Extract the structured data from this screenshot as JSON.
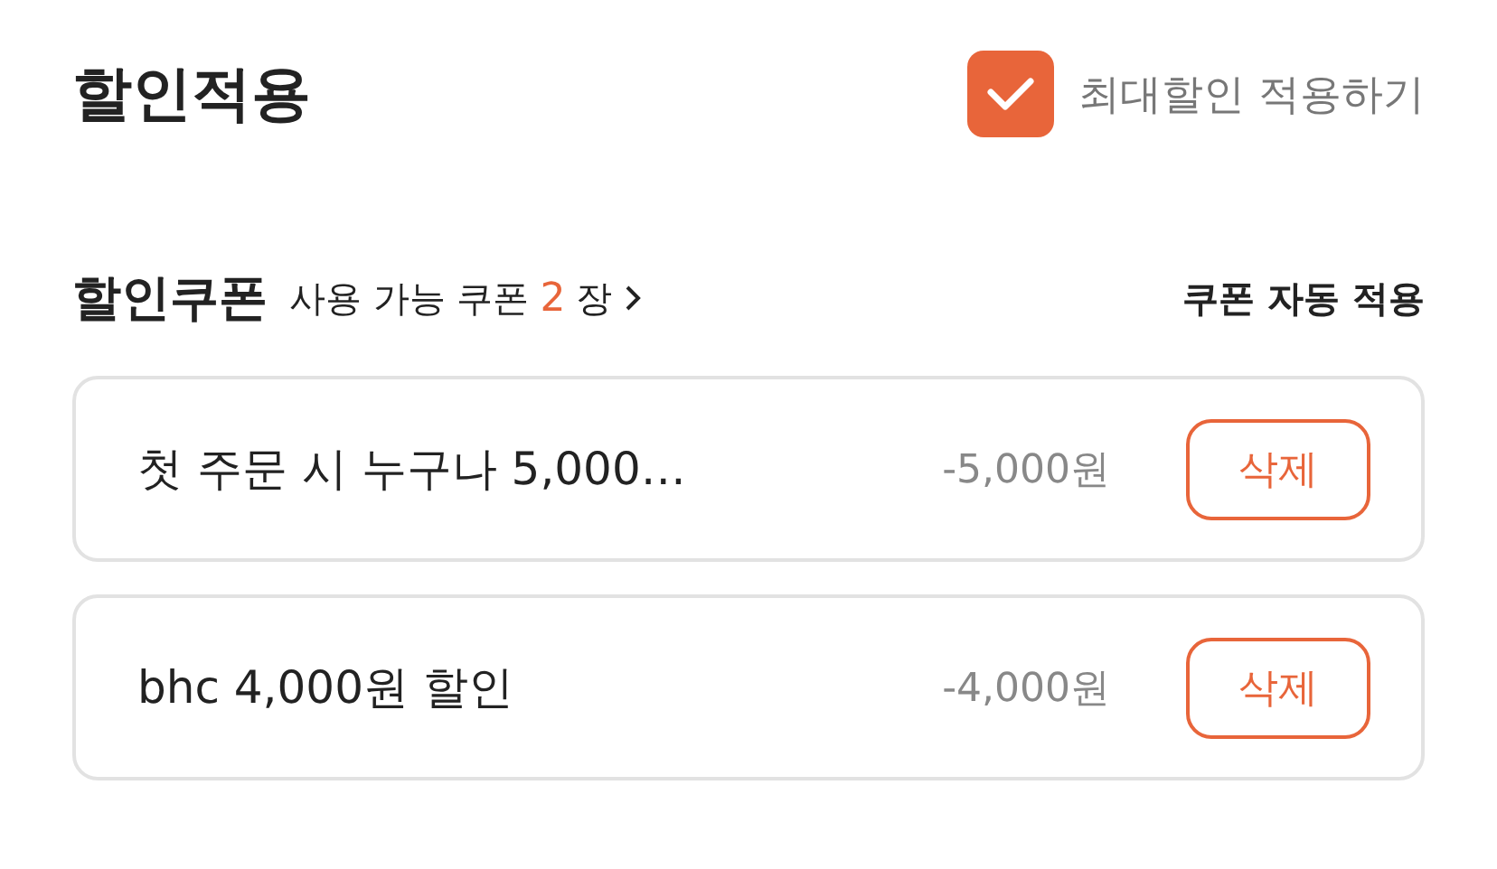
{
  "header": {
    "title": "할인적용",
    "max_discount": {
      "label": "최대할인 적용하기",
      "checked": true
    }
  },
  "coupons": {
    "title": "할인쿠폰",
    "available_prefix": "사용 가능 쿠폰",
    "available_count": "2",
    "available_suffix": "장",
    "auto_apply": "쿠폰 자동 적용",
    "items": [
      {
        "name": "첫 주문 시 누구나 5,000…",
        "amount": "-5,000원",
        "action": "삭제"
      },
      {
        "name": "bhc 4,000원 할인",
        "amount": "-4,000원",
        "action": "삭제"
      }
    ]
  }
}
